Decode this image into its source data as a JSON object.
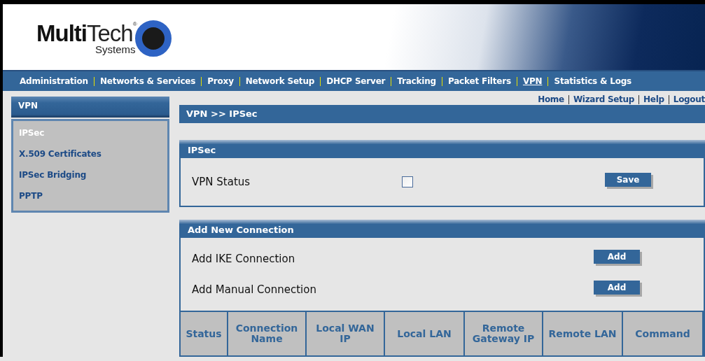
{
  "logo": {
    "word_1": "Multi",
    "word_2": "Tech",
    "mark": "®",
    "subtitle": "Systems"
  },
  "nav": [
    {
      "label": "Administration",
      "selected": false
    },
    {
      "label": "Networks & Services",
      "selected": false
    },
    {
      "label": "Proxy",
      "selected": false
    },
    {
      "label": "Network Setup",
      "selected": false
    },
    {
      "label": "DHCP Server",
      "selected": false
    },
    {
      "label": "Tracking",
      "selected": false
    },
    {
      "label": "Packet Filters",
      "selected": false
    },
    {
      "label": "VPN",
      "selected": true
    },
    {
      "label": "Statistics & Logs",
      "selected": false
    }
  ],
  "top_links": [
    "Home",
    "Wizard Setup",
    "Help",
    "Logout"
  ],
  "sidebar": {
    "title": "VPN",
    "items": [
      {
        "label": "IPSec",
        "selected": true
      },
      {
        "label": "X.509 Certificates",
        "selected": false
      },
      {
        "label": "IPSec Bridging",
        "selected": false
      },
      {
        "label": "PPTP",
        "selected": false
      }
    ]
  },
  "breadcrumb": "VPN >> IPSec",
  "ipsec_panel": {
    "title": "IPSec",
    "label": "VPN Status",
    "checked": false,
    "button": "Save"
  },
  "connection_panel": {
    "title": "Add New Connection",
    "rows": [
      {
        "label": "Add IKE Connection",
        "button": "Add"
      },
      {
        "label": "Add Manual Connection",
        "button": "Add"
      }
    ],
    "columns": [
      "Status",
      "Connection Name",
      "Local WAN IP",
      "Local LAN",
      "Remote Gateway IP",
      "Remote LAN",
      "Command"
    ]
  }
}
